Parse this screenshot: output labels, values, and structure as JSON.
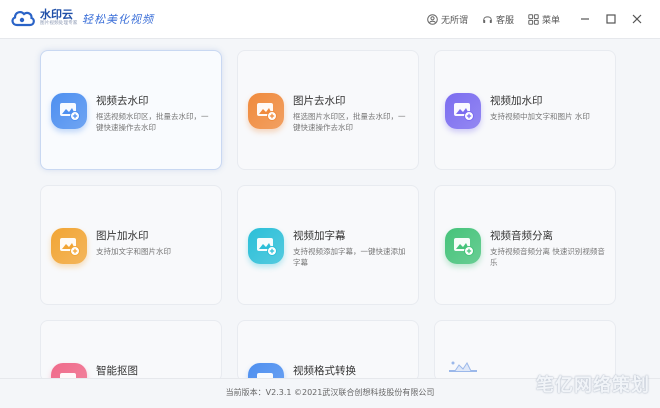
{
  "app": {
    "logo_title": "水印云",
    "logo_subtitle": "图片视频处理专家",
    "slogan": "轻松美化视频"
  },
  "titlebar": {
    "no_watermark": "无所谓",
    "service": "客服",
    "menu": "菜单"
  },
  "colors": {
    "accent": "#3b6fd8",
    "blue": "#4d8ff0",
    "orange": "#f08a3c",
    "purple": "#7b6cf0",
    "amber": "#f2a534",
    "cyan": "#2bbfd8",
    "green": "#45c37a",
    "pink": "#f06a8a"
  },
  "cards": [
    {
      "title": "视频去水印",
      "desc": "框选视频水印区，批量去水印，一键快速操作去水印",
      "icon": "video-remove-icon",
      "color": "#4d8ff0"
    },
    {
      "title": "图片去水印",
      "desc": "框选图片水印区，批量去水印，一键快速操作去水印",
      "icon": "image-remove-icon",
      "color": "#f08a3c"
    },
    {
      "title": "视频加水印",
      "desc": "支持视频中加文字和图片 水印",
      "icon": "video-add-icon",
      "color": "#7b6cf0"
    },
    {
      "title": "图片加水印",
      "desc": "支持加文字和图片水印",
      "icon": "image-add-icon",
      "color": "#f2a534"
    },
    {
      "title": "视频加字幕",
      "desc": "支持视频添加字幕，一键快速添加字幕",
      "icon": "subtitle-icon",
      "color": "#2bbfd8"
    },
    {
      "title": "视频音频分离",
      "desc": "支持视频音频分离 快速识别视频音乐",
      "icon": "audio-separate-icon",
      "color": "#45c37a"
    },
    {
      "title": "智能抠图",
      "desc": "",
      "icon": "cutout-icon",
      "color": "#f06a8a"
    },
    {
      "title": "视频格式转换",
      "desc": "",
      "icon": "convert-icon",
      "color": "#4d8ff0"
    },
    {
      "title": "",
      "desc": "",
      "icon": "more-icon",
      "color": "#9bb8ea"
    }
  ],
  "footer": {
    "version": "当前版本：V2.3.1 ©2021武汉联合创想科技股份有限公司"
  },
  "watermark": "笔亿网络策划"
}
